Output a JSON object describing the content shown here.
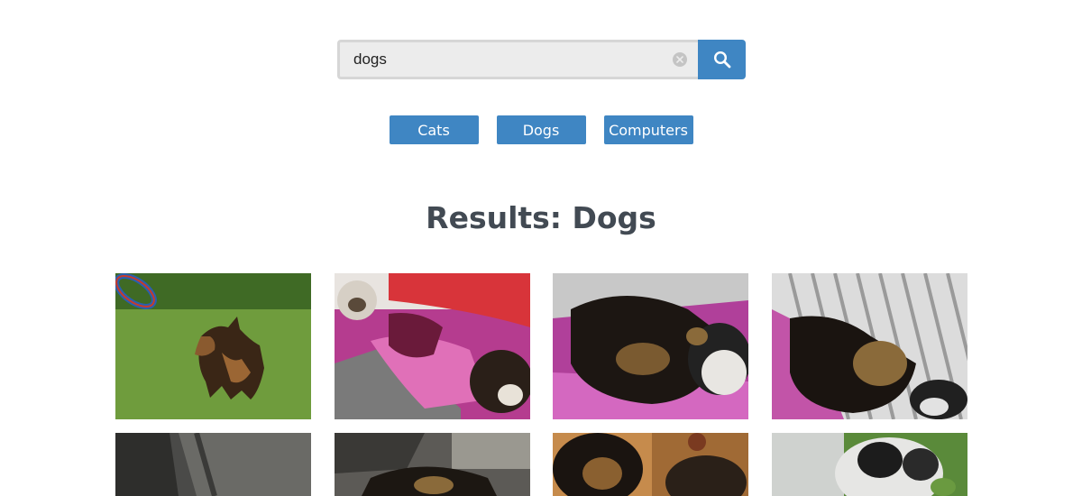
{
  "search": {
    "value": "dogs"
  },
  "categories": [
    "Cats",
    "Dogs",
    "Computers"
  ],
  "results": {
    "heading": "Results: Dogs"
  },
  "colors": {
    "accent": "#3f86c3",
    "heading": "#424a53",
    "search_background": "#ececec"
  },
  "icons": {
    "search_button": "search-icon",
    "clear_button": "clear-icon"
  },
  "photos": [
    {
      "subject": "german shepherd mix running on grass with frisbee"
    },
    {
      "subject": "puppy on pink patterned blanket"
    },
    {
      "subject": "sleeping puppies on pink blanket"
    },
    {
      "subject": "puppies on striped pillow"
    },
    {
      "subject": "dog on grey couch"
    },
    {
      "subject": "yorkshire puppy on couch"
    },
    {
      "subject": "puppies on wooden floor"
    },
    {
      "subject": "fluffy white and black puppy on grass"
    }
  ]
}
